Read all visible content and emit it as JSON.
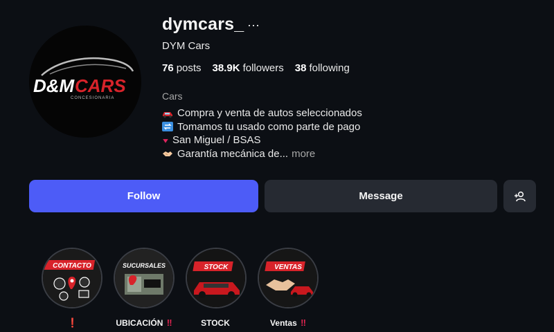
{
  "profile": {
    "username": "dymcars_",
    "more_options": "···",
    "full_name": "DYM Cars",
    "logo_text_main": "D&M",
    "logo_text_accent": "CARS",
    "logo_text_sub": "CONCESIONARIA"
  },
  "stats": {
    "posts_count": "76",
    "posts_label": "posts",
    "followers_count": "38.9K",
    "followers_label": "followers",
    "following_count": "38",
    "following_label": "following"
  },
  "bio": {
    "category": "Cars",
    "lines": [
      {
        "icon": "car-icon",
        "text": "Compra y venta de autos seleccionados"
      },
      {
        "icon": "exchange-icon",
        "text": "Tomamos tu usado como parte de pago"
      },
      {
        "icon": "location-pin-icon",
        "text": "San Miguel / BSAS"
      },
      {
        "icon": "handshake-icon",
        "text": "Garantía mecánica de..."
      }
    ],
    "more_label": "more"
  },
  "actions": {
    "follow_label": "Follow",
    "message_label": "Message",
    "add_user_icon": "add-user-icon"
  },
  "highlights": [
    {
      "cover_text": "CONTACTO",
      "label": "",
      "marker": "❗"
    },
    {
      "cover_text": "SUCURSALES",
      "label": "UBICACIÓN",
      "marker": "‼"
    },
    {
      "cover_text": "STOCK",
      "label": "STOCK",
      "marker": ""
    },
    {
      "cover_text": "VENTAS",
      "label": "Ventas",
      "marker": "‼"
    }
  ],
  "colors": {
    "background": "#0c0f14",
    "follow_button": "#4d5cf7",
    "secondary_button": "#262a32",
    "logo_red": "#d8232a",
    "highlight_marker": "#e02450"
  }
}
